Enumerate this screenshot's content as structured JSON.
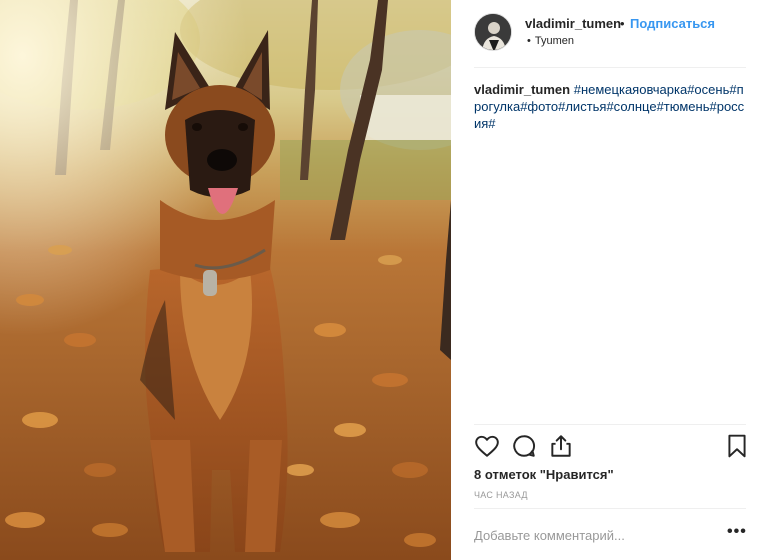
{
  "post": {
    "username": "vladimir_tumen",
    "separator_dot": "•",
    "follow_label": "Подписаться",
    "location_bullet": "•",
    "location": "Tyumen",
    "caption": {
      "username": "vladimir_tumen",
      "hashtags": "#немецкаяовчарка#осень#прогулка#фото#листья#солнце#тюмень#россия#"
    },
    "likes_text": "8 отметок \"Нравится\"",
    "time_text": "час назад",
    "comment_placeholder": "Добавьте комментарий...",
    "more_label": "•••"
  },
  "icons": {
    "like": "heart-icon",
    "comment": "comment-bubble-icon",
    "share": "share-upload-icon",
    "save": "bookmark-icon"
  },
  "colors": {
    "follow_blue": "#3897f0",
    "hashtag_link": "#003569",
    "muted_gray": "#999999",
    "text_dark": "#262626"
  }
}
